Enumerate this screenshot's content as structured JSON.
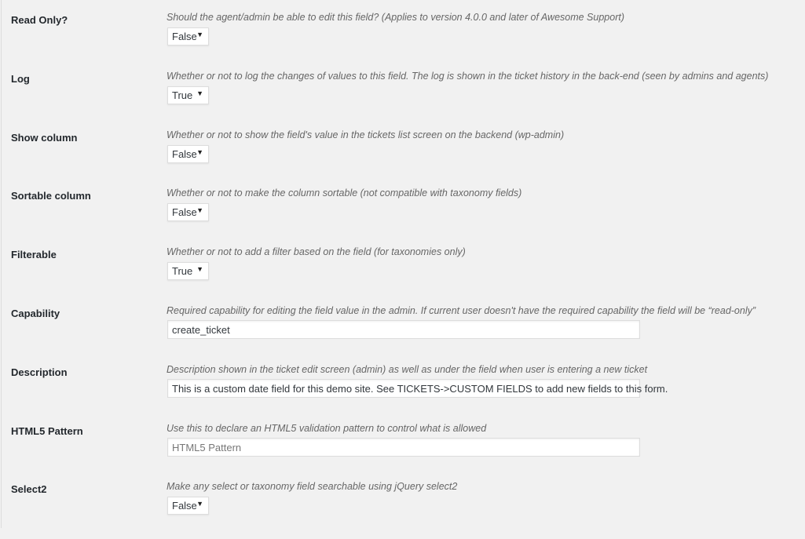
{
  "fields": [
    {
      "label": "Read Only?",
      "description": "Should the agent/admin be able to edit this field? (Applies to version 4.0.0 and later of Awesome Support)",
      "type": "select",
      "value": "False"
    },
    {
      "label": "Log",
      "description": "Whether or not to log the changes of values to this field. The log is shown in the ticket history in the back-end (seen by admins and agents)",
      "type": "select",
      "value": "True"
    },
    {
      "label": "Show column",
      "description": "Whether or not to show the field's value in the tickets list screen on the backend (wp-admin)",
      "type": "select",
      "value": "False"
    },
    {
      "label": "Sortable column",
      "description": "Whether or not to make the column sortable (not compatible with taxonomy fields)",
      "type": "select",
      "value": "False"
    },
    {
      "label": "Filterable",
      "description": "Whether or not to add a filter based on the field (for taxonomies only)",
      "type": "select",
      "value": "True"
    },
    {
      "label": "Capability",
      "description": "Required capability for editing the field value in the admin. If current user doesn't have the required capability the field will be “read-only”",
      "type": "input",
      "value": "create_ticket",
      "placeholder": ""
    },
    {
      "label": "Description",
      "description": "Description shown in the ticket edit screen (admin) as well as under the field when user is entering a new ticket",
      "type": "input",
      "value": "This is a custom date field for this demo site. See TICKETS->CUSTOM FIELDS to add new fields to this form.",
      "placeholder": ""
    },
    {
      "label": "HTML5 Pattern",
      "description": "Use this to declare an HTML5 validation pattern to control what is allowed",
      "type": "input",
      "value": "",
      "placeholder": "HTML5 Pattern"
    },
    {
      "label": "Select2",
      "description": "Make any select or taxonomy field searchable using jQuery select2",
      "type": "select",
      "value": "False"
    }
  ],
  "icons": {
    "dropdown": "caret-down-icon"
  }
}
